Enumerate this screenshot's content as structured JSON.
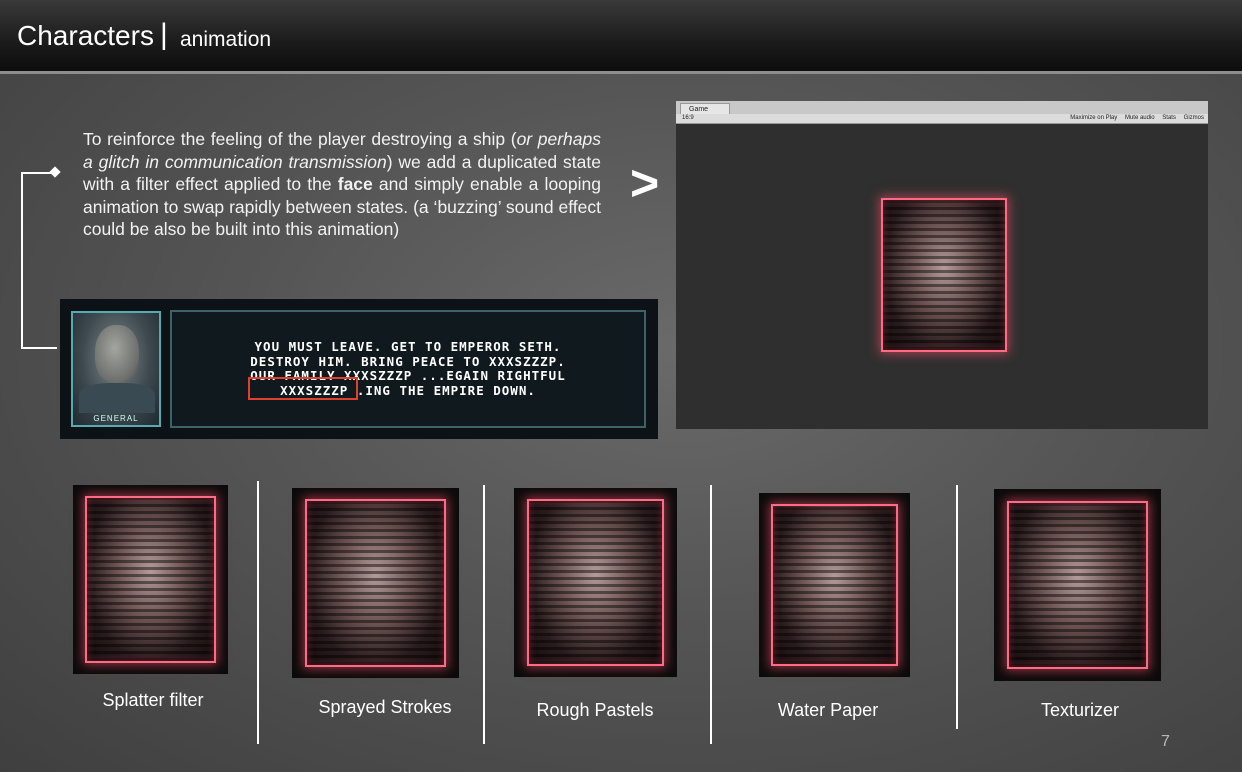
{
  "header": {
    "title": "Characters",
    "separator": "|",
    "subtitle": "animation"
  },
  "paragraph": {
    "p1": "To reinforce the feeling of the player destroying a ship (",
    "p2": "or perhaps a glitch in communication transmission",
    "p3": ") we add  a duplicated state with a filter effect  applied to the ",
    "p4": "face",
    "p5": " and simply enable a looping animation to swap rapidly between states. (a ‘buzzing’ sound effect could be also be built into this animation)"
  },
  "arrow": ">",
  "dialog": {
    "portrait_label": "GENERAL",
    "lines": [
      "YOU MUST LEAVE. GET TO EMPEROR SETH.",
      "DESTROY HIM. BRING PEACE TO XXXSZZZP.",
      "OUR FAMILY XXXSZZZP ...EGAIN RIGHTFUL",
      "XXXSZZZP .ING THE EMPIRE DOWN."
    ]
  },
  "game_window": {
    "tab": "Game",
    "aspect": "16:9",
    "tools": [
      "Maximize on Play",
      "Mute audio",
      "Stats",
      "Gizmos"
    ]
  },
  "filters": [
    {
      "caption": "Splatter filter"
    },
    {
      "caption": "Sprayed Strokes"
    },
    {
      "caption": "Rough Pastels"
    },
    {
      "caption": "Water Paper"
    },
    {
      "caption": "Texturizer"
    }
  ],
  "page_number": "7",
  "colors": {
    "glow": "#ff6b85",
    "highlight_box": "#e0402f",
    "portrait_border": "#56aab0"
  }
}
